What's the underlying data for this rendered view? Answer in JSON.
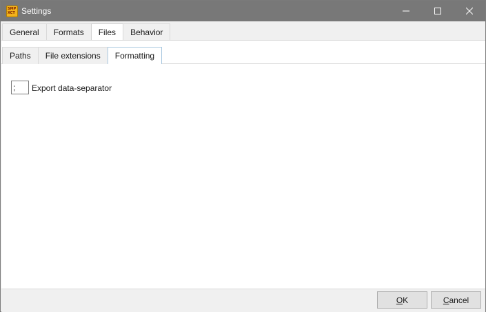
{
  "window": {
    "title": "Settings",
    "icon_name": "app-icon",
    "icon_text_1": "SMP",
    "icon_text_2": "XCT"
  },
  "outer_tabs": [
    {
      "label": "General",
      "active": false
    },
    {
      "label": "Formats",
      "active": false
    },
    {
      "label": "Files",
      "active": true
    },
    {
      "label": "Behavior",
      "active": false
    }
  ],
  "inner_tabs": [
    {
      "label": "Paths",
      "active": false
    },
    {
      "label": "File extensions",
      "active": false
    },
    {
      "label": "Formatting",
      "active": true
    }
  ],
  "formatting": {
    "separator_value": ";",
    "separator_label": "Export data-separator"
  },
  "buttons": {
    "ok_accel": "O",
    "ok_rest": "K",
    "cancel_accel": "C",
    "cancel_rest": "ancel"
  },
  "colors": {
    "titlebar": "#787878",
    "icon_bg": "#f2b21b"
  }
}
